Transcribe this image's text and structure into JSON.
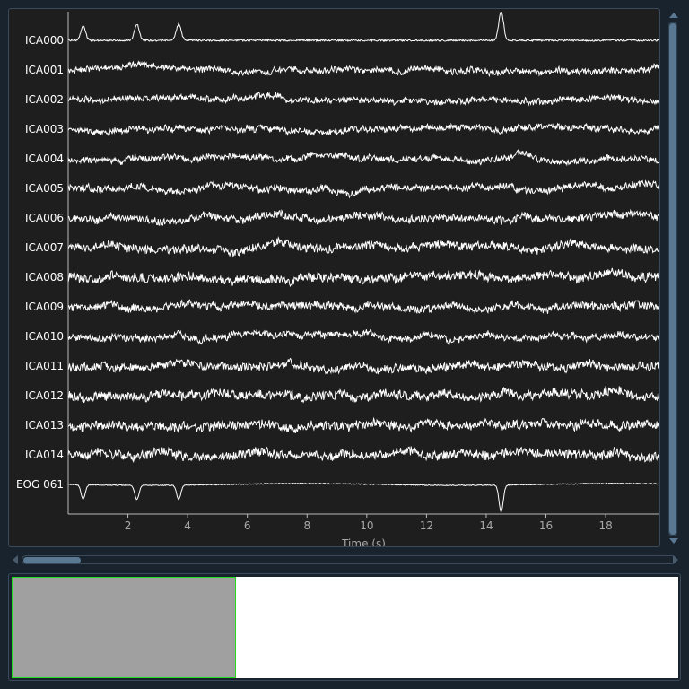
{
  "viewer": {
    "channels": [
      "ICA000",
      "ICA001",
      "ICA002",
      "ICA003",
      "ICA004",
      "ICA005",
      "ICA006",
      "ICA007",
      "ICA008",
      "ICA009",
      "ICA010",
      "ICA011",
      "ICA012",
      "ICA013",
      "ICA014",
      "EOG 061"
    ],
    "x_axis": {
      "label": "Time (s)",
      "ticks": [
        2,
        4,
        6,
        8,
        10,
        12,
        14,
        16,
        18
      ],
      "range": [
        0,
        19.8
      ]
    },
    "eye_blink_times_s": [
      0.5,
      2.3,
      3.7,
      14.5
    ],
    "trace_color": "#ffffff",
    "background_color": "#1e1e1e"
  },
  "overview": {
    "visible_window_fraction": 0.337,
    "window_color": "#a0a0a0",
    "window_border_color": "#22dd22"
  },
  "vertical_scroll": {
    "position_fraction": 0.0
  },
  "horizontal_scroll": {
    "position_fraction": 0.0
  }
}
